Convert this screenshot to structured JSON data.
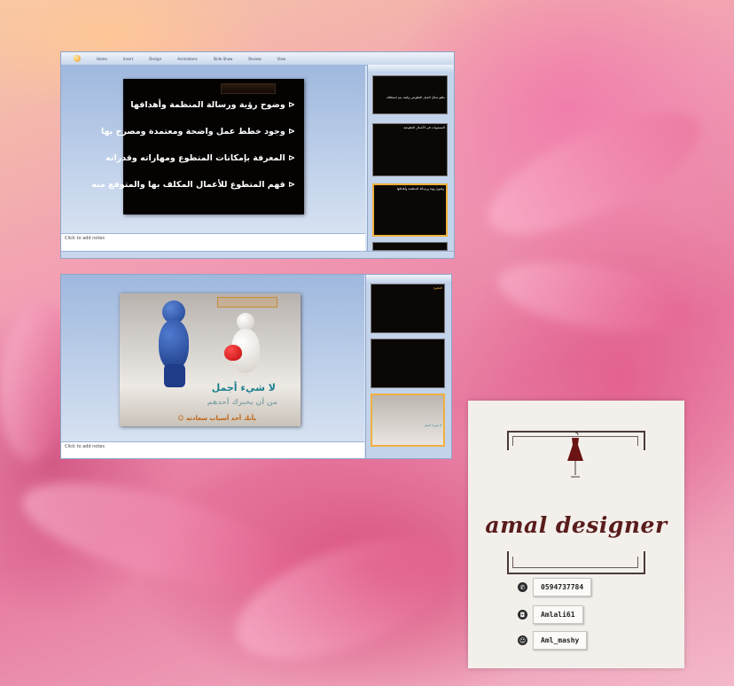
{
  "ribbon_tabs": [
    "Home",
    "Insert",
    "Design",
    "Animations",
    "Slide Show",
    "Review",
    "View"
  ],
  "window1": {
    "notes_placeholder": "Click to add notes",
    "slide_bullets": [
      "⊲ وضوح رؤية ورسالة المنظمة وأهدافها",
      "⊲ وجود خطط عمل واضحة ومعتمدة ومصرح بها",
      "⊲ المعرفة بإمكانات المتطوع ومهاراته وقدراته",
      "⊲ فهم المتطوع للأعمال المكلف بها والمتوقع منه"
    ],
    "thumbnails": [
      "ماهو شكل العمل التطوعي وكيف يتم استغلاله",
      "المستويات في الأعمال التطوعية",
      "وضوح رؤية ورسالة المنظمة وأهدافها"
    ]
  },
  "window2": {
    "notes_placeholder": "Click to add notes",
    "slide_caption_main": "لا شيء أجمل",
    "slide_caption_sub": "من أن يخبرك أحدهم",
    "slide_caption_bottom": "بأنك أحد أسباب سعادته ☺",
    "thumbnails": [
      "التطوع",
      "",
      "لا شيء أجمل"
    ]
  },
  "card": {
    "brand": "amal designer",
    "contacts": [
      {
        "icon": "whatsapp-icon",
        "glyph": "✆",
        "text": "0594737784"
      },
      {
        "icon": "instagram-icon",
        "glyph": "◘",
        "text": "Amlali61"
      },
      {
        "icon": "snapchat-icon",
        "glyph": "☺",
        "text": "Aml_mashy"
      }
    ]
  }
}
